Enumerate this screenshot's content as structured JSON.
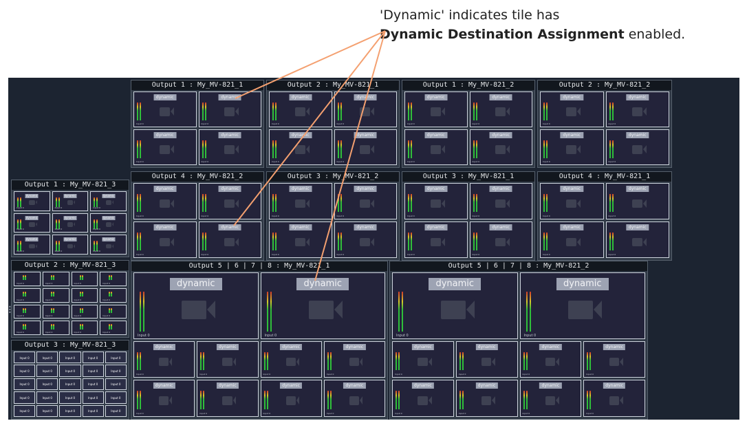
{
  "callout": {
    "line1": "'Dynamic' indicates tile has",
    "line2_bold": "Dynamic Destination Assignment",
    "line2_rest": " enabled."
  },
  "colors": {
    "wall_bg": "#1c2431",
    "group_header": "#12171e",
    "tile_bg": "#23233a",
    "tile_border": "#cfd6df",
    "badge_bg": "#9da3b3",
    "leader_line": "#f4a070"
  },
  "icons": {
    "tile_placeholder": "camera-icon",
    "level": "audio-meter-icon"
  },
  "tile_badge_text": "dynamic",
  "tile_input_label": "Input 0",
  "groups": [
    {
      "title": "Output 1 : My_MV-821_1"
    },
    {
      "title": "Output 2 : My_MV-821_1"
    },
    {
      "title": "Output 1 : My_MV-821_2"
    },
    {
      "title": "Output 2 : My_MV-821_2"
    },
    {
      "title": "Output 4 : My_MV-821_2"
    },
    {
      "title": "Output 3 : My_MV-821_2"
    },
    {
      "title": "Output 3 : My_MV-821_1"
    },
    {
      "title": "Output 4 : My_MV-821_1"
    },
    {
      "title": "Output 1 : My_MV-821_3"
    },
    {
      "title": "Output 2 : My_MV-821_3"
    },
    {
      "title": "Output 3 : My_MV-821_3"
    },
    {
      "title": "Output 5 | 6 | 7 | 8 : My_MV-821_1"
    },
    {
      "title": "Output 5 | 6 | 7 | 8 : My_MV-821_2"
    }
  ]
}
